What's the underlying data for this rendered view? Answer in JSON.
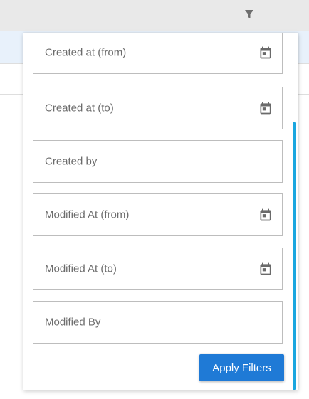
{
  "header": {
    "filter_icon": "filter-icon"
  },
  "filters": {
    "fields": [
      {
        "label": "Created at (from)",
        "icon": "calendar-icon"
      },
      {
        "label": "Created at (to)",
        "icon": "calendar-icon"
      },
      {
        "label": "Created by",
        "icon": ""
      },
      {
        "label": "Modified At (from)",
        "icon": "calendar-icon"
      },
      {
        "label": "Modified At (to)",
        "icon": "calendar-icon"
      },
      {
        "label": "Modified By",
        "icon": ""
      }
    ],
    "apply_label": "Apply Filters"
  },
  "colors": {
    "accent": "#1f7ad6",
    "scrollbar": "#1aa6df",
    "selected_row": "#e8f1fb"
  }
}
